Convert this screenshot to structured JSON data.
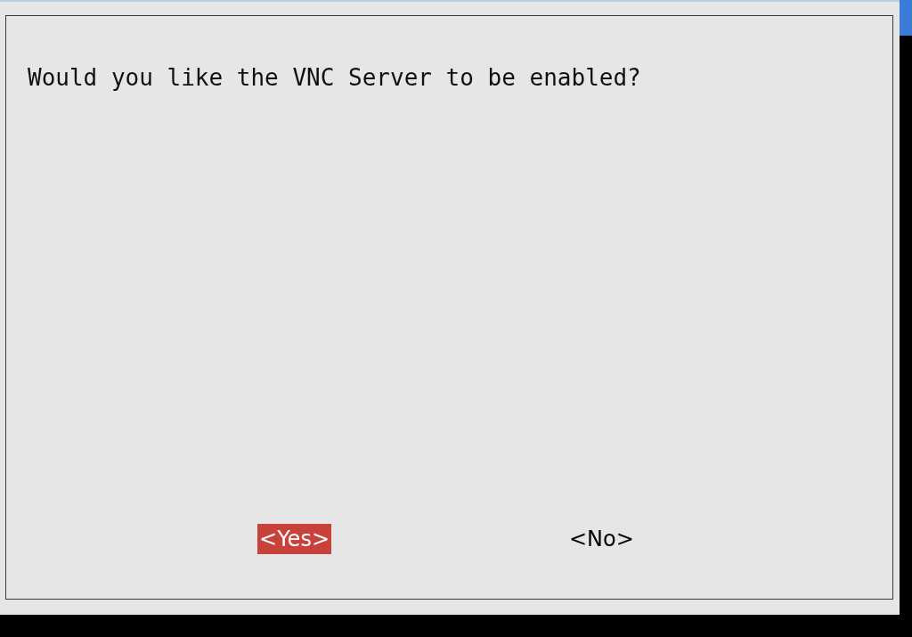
{
  "dialog": {
    "message": "Would you like the VNC Server to be enabled?",
    "buttons": [
      {
        "label": "<Yes>",
        "selected": true
      },
      {
        "label": "<No>",
        "selected": false
      }
    ]
  }
}
